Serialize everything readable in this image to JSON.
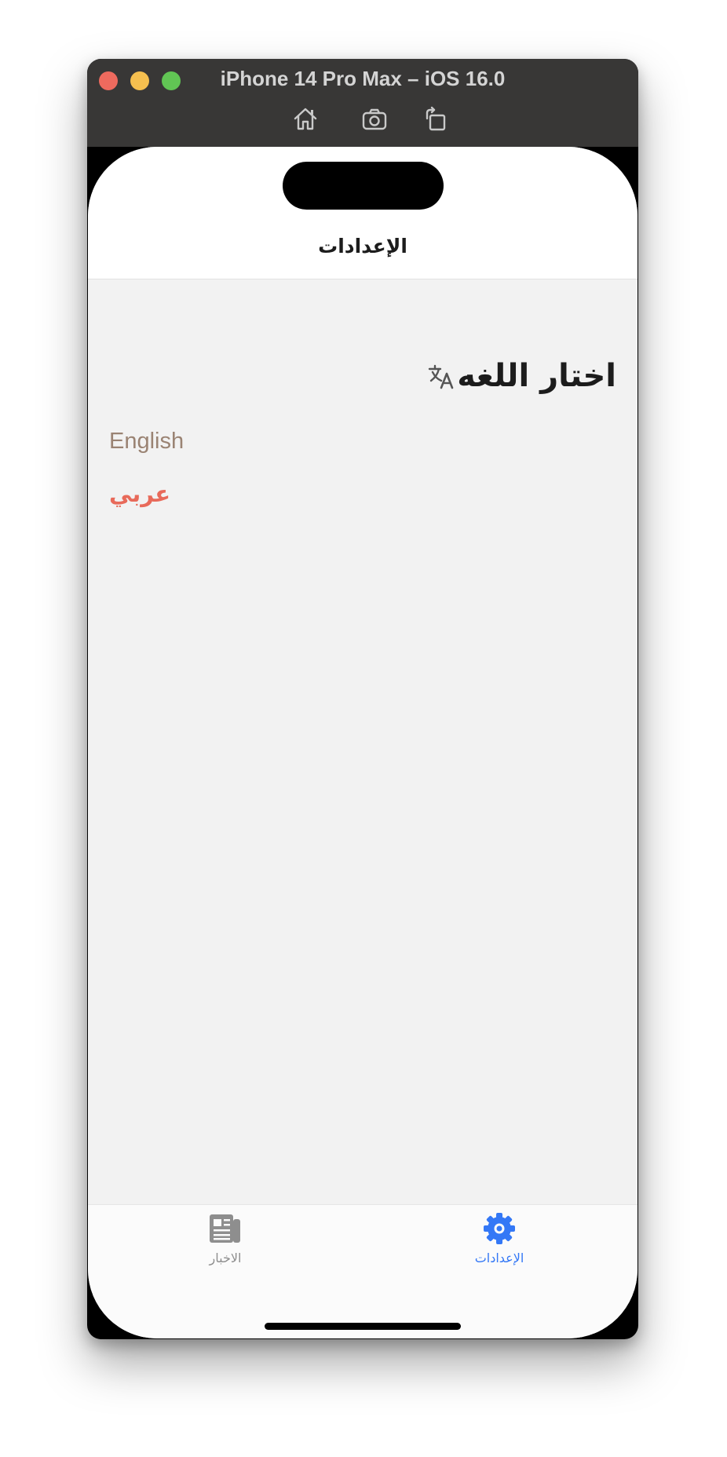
{
  "simulator": {
    "title": "iPhone 14 Pro Max – iOS 16.0",
    "toolbar": [
      "home-icon",
      "screenshot-icon",
      "rotate-icon"
    ]
  },
  "navbar": {
    "title": "الإعدادات"
  },
  "language_section": {
    "title": "اختار اللغه",
    "icon": "translate-icon",
    "options": [
      {
        "label": "English",
        "color": "#9a8373",
        "selected": false
      },
      {
        "label": "عربي",
        "color": "#e86a5a",
        "selected": true
      }
    ]
  },
  "tabbar": {
    "items": [
      {
        "label": "الاخبار",
        "icon": "newspaper-icon",
        "active": false,
        "color": "#8e8e8e"
      },
      {
        "label": "الإعدادات",
        "icon": "gear-icon",
        "active": true,
        "color": "#3478f6"
      }
    ]
  }
}
